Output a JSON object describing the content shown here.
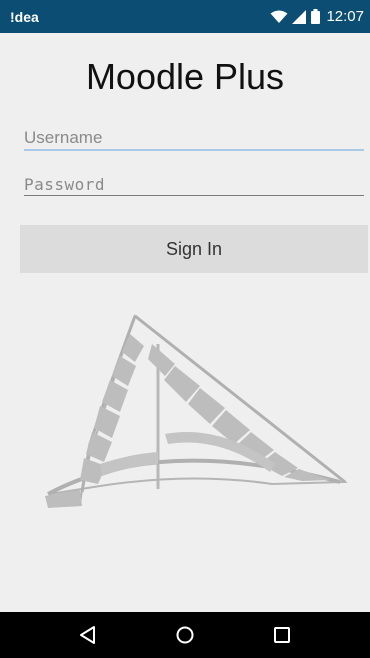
{
  "status_bar": {
    "app_label": "!dea",
    "time": "12:07",
    "icons": [
      "wifi-icon",
      "signal-icon",
      "battery-icon"
    ]
  },
  "title": "Moodle Plus",
  "form": {
    "username_placeholder": "Username",
    "username_value": "",
    "password_placeholder": "Password",
    "password_value": "",
    "sign_in_label": "Sign In"
  },
  "logo": "hang-glider-logo",
  "nav_bar": {
    "icons": [
      "back-icon",
      "home-icon",
      "recents-icon"
    ]
  },
  "colors": {
    "status_bar": "#0c4d73",
    "background": "#efefef",
    "button": "#dcdcdc",
    "focus_underline": "#aac9e6",
    "nav_bar": "#000000"
  }
}
